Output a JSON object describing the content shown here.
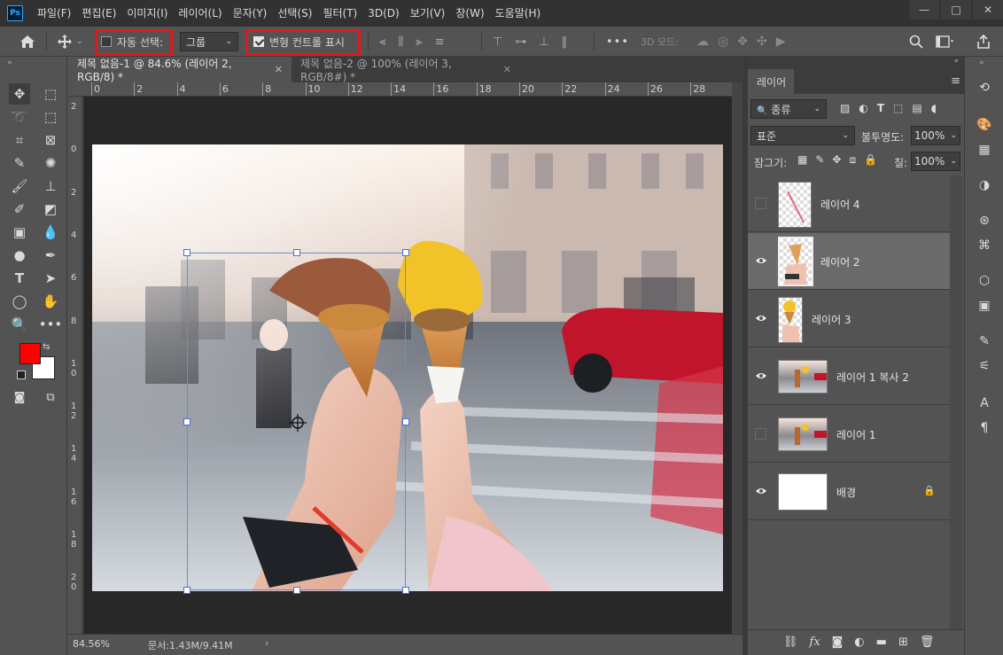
{
  "menu": {
    "app_logo": "Ps",
    "items": [
      "파일(F)",
      "편집(E)",
      "이미지(I)",
      "레이어(L)",
      "문자(Y)",
      "선택(S)",
      "필터(T)",
      "3D(D)",
      "보기(V)",
      "창(W)",
      "도움말(H)"
    ]
  },
  "window_controls": {
    "minimize": "—",
    "maximize": "□",
    "close": "✕"
  },
  "options_bar": {
    "auto_select_label": "자동 선택:",
    "auto_select_checked": false,
    "group_select_value": "그룹",
    "show_transform_label": "변형 컨트롤 표시",
    "show_transform_checked": true,
    "three_d_mode_label": "3D 모드:",
    "more_label": "•••",
    "highlight_color": "#e0191f"
  },
  "document_tabs": [
    {
      "label": "제목 없음-1 @ 84.6% (레이어 2, RGB/8) *",
      "active": true
    },
    {
      "label": "제목 없음-2 @ 100% (레이어 3, RGB/8#) *",
      "active": false
    }
  ],
  "ruler": {
    "top_ticks": [
      "0",
      "2",
      "4",
      "6",
      "8",
      "10",
      "12",
      "14",
      "16",
      "18",
      "20",
      "22",
      "24",
      "26",
      "28"
    ],
    "left_ticks": [
      "2",
      "0",
      "2",
      "4",
      "6",
      "8",
      "10",
      "12",
      "14",
      "16",
      "18",
      "20"
    ]
  },
  "status_bar": {
    "zoom": "84.56%",
    "doc_info": "문서:1.43M/9.41M",
    "arrow": "›"
  },
  "tools": {
    "foreground_color": "#ff0000",
    "background_color": "#ffffff"
  },
  "layers_panel": {
    "tab_label": "레이어",
    "filter_kind": "종류",
    "blend_mode": "표준",
    "opacity_label": "불투명도:",
    "opacity_value": "100%",
    "lock_label": "잠그기:",
    "fill_label": "칠:",
    "fill_value": "100%",
    "layers": [
      {
        "name": "레이어 4",
        "visible": false,
        "selected": false,
        "thumb": "checker-hand"
      },
      {
        "name": "레이어 2",
        "visible": true,
        "selected": true,
        "thumb": "checker-cone"
      },
      {
        "name": "레이어 3",
        "visible": true,
        "selected": false,
        "thumb": "checker-cone-yellow"
      },
      {
        "name": "레이어 1 복사 2",
        "visible": true,
        "selected": false,
        "thumb": "photo"
      },
      {
        "name": "레이어 1",
        "visible": false,
        "selected": false,
        "thumb": "photo"
      },
      {
        "name": "배경",
        "visible": true,
        "selected": false,
        "thumb": "white",
        "locked": true
      }
    ],
    "bottom_icons": [
      "link-icon",
      "fx-icon",
      "mask-icon",
      "adjustment-icon",
      "folder-icon",
      "new-layer-icon",
      "trash-icon"
    ]
  }
}
